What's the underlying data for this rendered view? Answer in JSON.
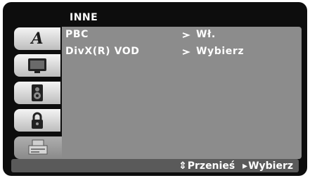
{
  "menu": {
    "title": "INNE",
    "items": [
      {
        "label": "PBC",
        "value": "Wł."
      },
      {
        "label": "DivX(R) VOD",
        "value": "Wybierz"
      }
    ]
  },
  "sidebar": {
    "tabs": [
      {
        "icon": "letter-a-icon",
        "glyph": "A",
        "active": false
      },
      {
        "icon": "tv-screen-icon",
        "active": false
      },
      {
        "icon": "speaker-icon",
        "active": false
      },
      {
        "icon": "padlock-icon",
        "active": false
      },
      {
        "icon": "disc-tray-others-icon",
        "active": true
      }
    ]
  },
  "footer": {
    "move_icon": "⇕",
    "move_label": "Przenieś",
    "select_icon": "▸",
    "select_label": "Wybierz"
  },
  "colors": {
    "background": "#0d0d0d",
    "panel": "#8c8c8c",
    "footer": "#5a5a5a",
    "text": "#ffffff"
  }
}
